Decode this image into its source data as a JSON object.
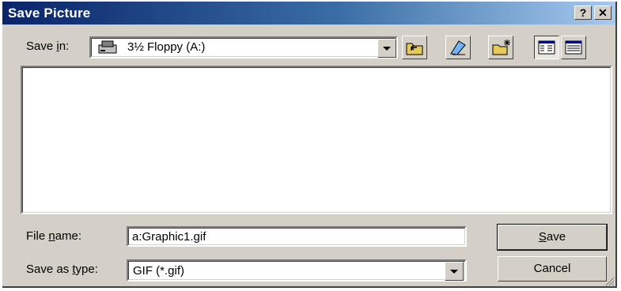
{
  "window": {
    "title": "Save Picture",
    "help_label": "?",
    "close_label": "✕"
  },
  "toolbar": {
    "save_in_label": "Save in:",
    "save_in_value": "3½ Floppy (A:)",
    "icons": [
      "floppy-drive-icon",
      "up-one-level-icon",
      "desktop-icon",
      "new-folder-icon",
      "list-view-icon",
      "details-view-icon"
    ]
  },
  "form": {
    "file_name_label": "File name:",
    "file_name_value": "a:Graphic1.gif",
    "save_type_label": "Save as type:",
    "save_type_value": "GIF (*.gif)"
  },
  "buttons": {
    "save": "Save",
    "cancel": "Cancel"
  }
}
